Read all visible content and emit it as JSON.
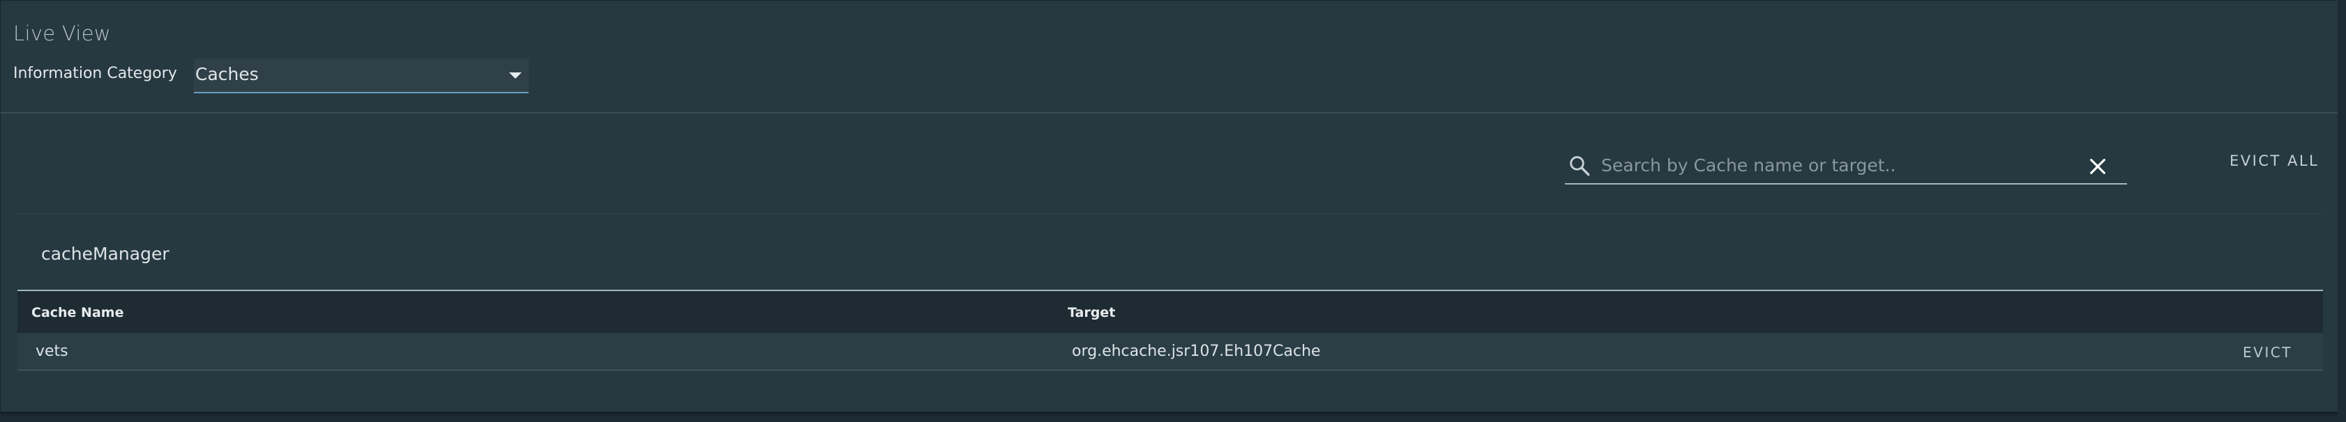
{
  "header": {
    "title": "Live View",
    "category_label": "Information Category",
    "category_value": "Caches"
  },
  "search": {
    "placeholder": "Search by Cache name or target..",
    "value": "",
    "evict_all_label": "EVICT ALL"
  },
  "cache_manager": {
    "name": "cacheManager",
    "columns": [
      "Cache Name",
      "Target"
    ],
    "rows": [
      {
        "cache_name": "vets",
        "target": "org.ehcache.jsr107.Eh107Cache",
        "action_label": "EVICT"
      }
    ]
  },
  "icons": {
    "search": "search-icon",
    "clear": "close-icon",
    "dropdown": "chevron-down-icon"
  }
}
